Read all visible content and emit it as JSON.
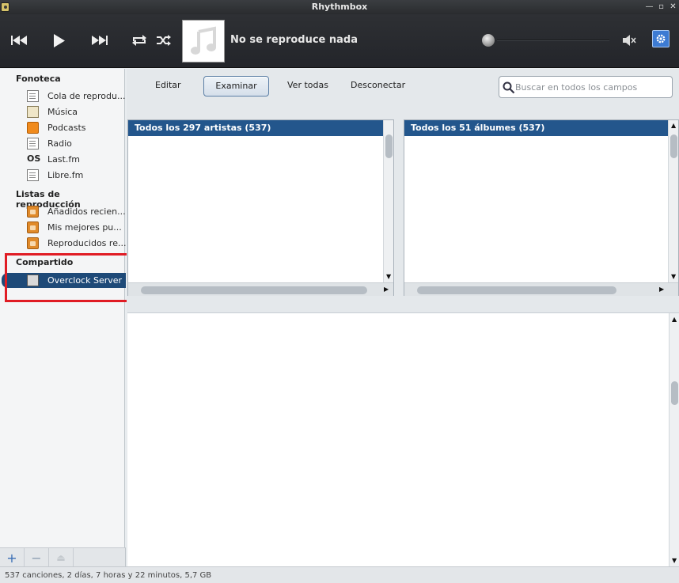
{
  "window": {
    "title": "Rhythmbox"
  },
  "player": {
    "now_playing": "No se reproduce nada",
    "icons": [
      "previous-icon",
      "play-icon",
      "next-icon",
      "repeat-icon",
      "shuffle-icon",
      "music-note-icon",
      "volume-mute-icon",
      "gear-icon"
    ]
  },
  "sidebar": {
    "library_header": "Fonoteca",
    "library_items": [
      {
        "label": "Cola de reprodu...",
        "icon": "queue-icon"
      },
      {
        "label": "Música",
        "icon": "music-icon"
      },
      {
        "label": "Podcasts",
        "icon": "rss-icon"
      },
      {
        "label": "Radio",
        "icon": "radio-icon"
      },
      {
        "label": "Last.fm",
        "icon": "lastfm-icon"
      },
      {
        "label": "Libre.fm",
        "icon": "librefm-icon"
      }
    ],
    "playlists_header": "Listas de reproducción",
    "playlist_items": [
      {
        "label": "Añadidos recien...",
        "icon": "smart-playlist-icon"
      },
      {
        "label": "Mis mejores pu...",
        "icon": "smart-playlist-icon"
      },
      {
        "label": "Reproducidos re...",
        "icon": "smart-playlist-icon"
      }
    ],
    "shared_header": "Compartido",
    "shared_items": [
      {
        "label": "Overclock Server",
        "icon": "shared-library-icon",
        "selected": true
      }
    ]
  },
  "main": {
    "toolbar": {
      "edit": "Editar",
      "browse": "Examinar",
      "show_all": "Ver todas",
      "disconnect": "Desconectar"
    },
    "search": {
      "placeholder": "Buscar en todos los campos"
    },
    "artists_header": "Todos los 297 artistas (537)",
    "albums_header": "Todos los 51 álbumes (537)"
  },
  "status": {
    "text": "537 canciones, 2 días, 7 horas y 22 minutos, 5,7 GB"
  },
  "colors": {
    "accent": "#23568c",
    "selection": "#1e4a78",
    "highlight_box": "#e01c24",
    "toolbar_bg": "#2a2c30"
  }
}
